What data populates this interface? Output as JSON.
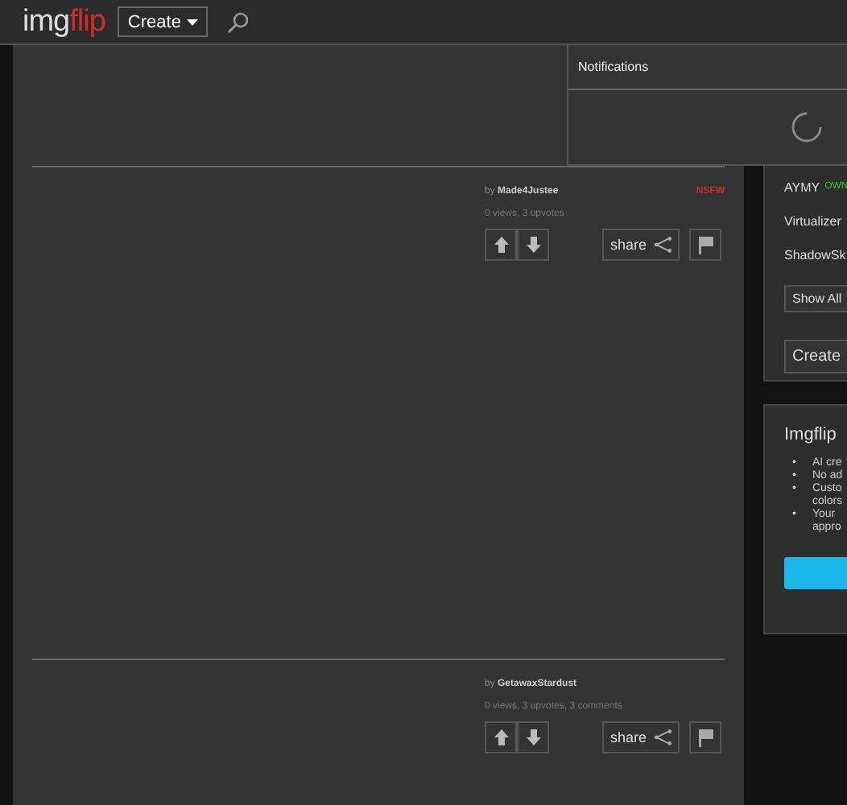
{
  "header": {
    "logo": {
      "part_1": "img",
      "part_2": "flip"
    },
    "create_button": "Create"
  },
  "notifications": {
    "title": "Notifications",
    "loading": true
  },
  "posts": [
    {
      "by": "by",
      "author": "Made4Justee",
      "nsfw": "NSFW",
      "stats": "0 views, 3 upvotes",
      "share": "share"
    },
    {
      "by": "by",
      "author": "GetawaxStardust",
      "stats": "0 views, 3 upvotes, 3 comments",
      "share": "share"
    }
  ],
  "sidebar": {
    "users": [
      {
        "name": "AYMY",
        "badge": "OWN"
      },
      {
        "name": "Virtualizer"
      },
      {
        "name": "ShadowSk"
      }
    ],
    "show_all": "Show All",
    "create_button": "Create"
  },
  "promo": {
    "title": "Imgflip",
    "bullet": "•",
    "features": [
      "AI cre",
      "No ad",
      "Custo colors",
      "Your appro"
    ]
  }
}
